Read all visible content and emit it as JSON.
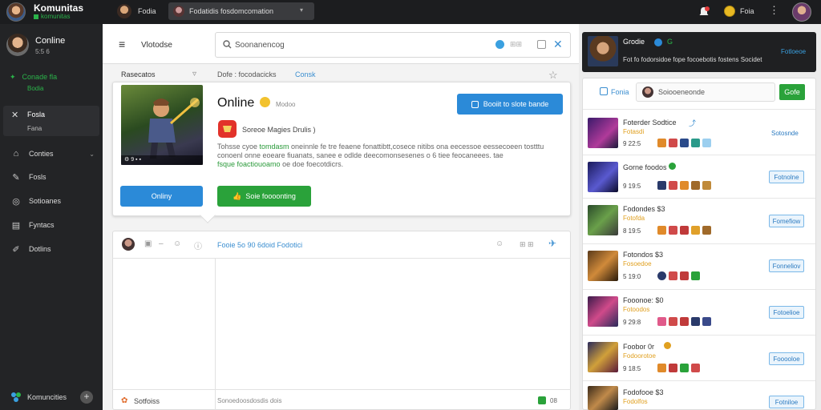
{
  "topbar": {
    "brand_title": "Komunitas",
    "brand_sub": "komunitas",
    "user_name": "Fodia",
    "tab_label": "Fodatidis fosdomcomation",
    "coin_label": "Foia"
  },
  "sidebar": {
    "user_name": "Conline",
    "user_sub": "5:5 6",
    "green_label": "Conade fla",
    "green_sub": "Bodia",
    "active_label": "Fosla",
    "active_sub": "Fana",
    "items": [
      {
        "label": "Conties",
        "icon": "home-icon"
      },
      {
        "label": "Fosls",
        "icon": "edit-icon"
      },
      {
        "label": "Sotioanes",
        "icon": "globe-icon"
      },
      {
        "label": "Fyntacs",
        "icon": "chart-icon"
      },
      {
        "label": "Dotlins",
        "icon": "pen-icon"
      }
    ],
    "bottom_label": "Komuncities"
  },
  "header": {
    "title": "Vlotodse",
    "search_value": "Soonanencog"
  },
  "breadcrumb": {
    "title": "Rasecatos",
    "path": "Dofe : focodacicks",
    "link": "Consk"
  },
  "card": {
    "status": "Online",
    "status_sub": "Modoo",
    "blue_button": "Booiit to slote bande",
    "app_label": "Soreoe Magies Drulis )",
    "desc_line1_a": "Tohsse cyoe ",
    "desc_line1_g": "tomdasm",
    "desc_line1_b": " oneinnle fe tre feaene fonattibtt,cosece nitibs ona eecessoe eessecoeen tostttu",
    "desc_line2": "conoenl onne eoeare fiuanats, sanee e odlde deecomonsesenes o 6 tiee feocaneees. tae",
    "desc_line3_g": "fsque foactiouoamo",
    "desc_line3_b": " oe doe foecotdicrs.",
    "play_button": "Onliny",
    "green_button": "Soie foooonting"
  },
  "chat": {
    "title": "Fooie 5o 90 6doid Fodotici",
    "footer_label": "Sotfoiss",
    "footer_input": "Sonoedoosdosdis dois",
    "footer_count": "08"
  },
  "right_panel": {
    "card_title": "Grodie",
    "card_badge2": "G",
    "card_desc": "Fot fo fodorsidoe fope focoebotis fostens Socidet",
    "card_link": "Fotloeoe",
    "filter_label": "Fonia",
    "search_value": "Soiooeneonde",
    "go_button": "Gofe",
    "rows": [
      {
        "name": "Foterder Sodtice",
        "tag": "Fotasdi",
        "meta": "9 22:5",
        "button": "Sotosnde",
        "plain": true
      },
      {
        "name": "Gorne foodos",
        "tag": "",
        "meta": "9 19:5",
        "button": "Fotnolne",
        "plain": false
      },
      {
        "name": "Fodondes $3",
        "tag": "Fotofda",
        "meta": "8 19:5",
        "button": "Fomefiow",
        "plain": false
      },
      {
        "name": "Fotondos $3",
        "tag": "Fosoedoe",
        "meta": "5 19:0",
        "button": "Fonneliov",
        "plain": false
      },
      {
        "name": "Fooonoe: $0",
        "tag": "Fotoodos",
        "meta": "9 29:8",
        "button": "Fotoelioe",
        "plain": false
      },
      {
        "name": "Foobor 0r",
        "tag": "Fodoorotoe",
        "meta": "9 18:5",
        "button": "Fooooloe",
        "plain": false
      },
      {
        "name": "Fodofooe $3",
        "tag": "Fodolfos",
        "meta": "",
        "button": "Fotniloe",
        "plain": false
      }
    ]
  },
  "colors": {
    "accent_blue": "#2b8ad8",
    "accent_green": "#2aa23a",
    "topbar": "#1c1d1f",
    "sidebar": "#232426"
  }
}
